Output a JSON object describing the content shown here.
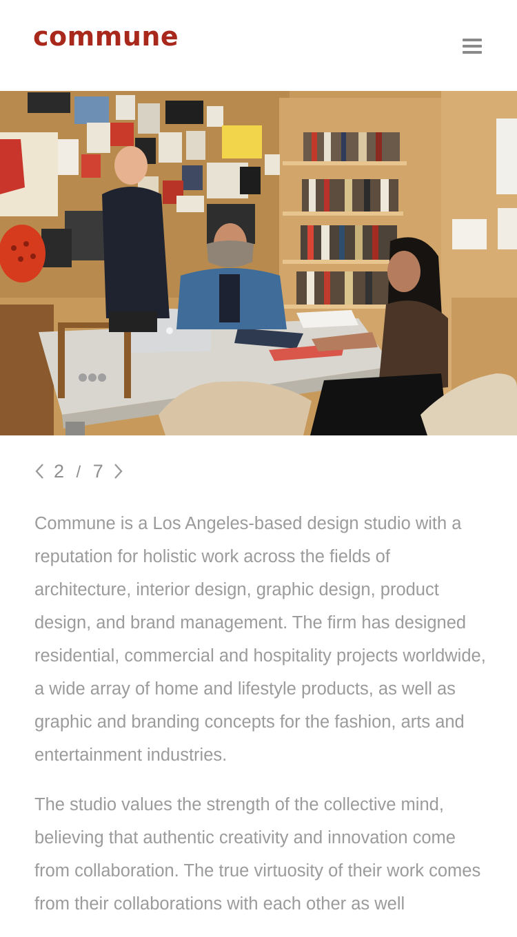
{
  "header": {
    "logo_text": "commune",
    "menu_icon": "hamburger-menu-icon"
  },
  "hero": {
    "image_description_icon": "photo-studio-meeting"
  },
  "pager": {
    "prev_icon": "chevron-left-icon",
    "current": "2",
    "separator": "/",
    "total": "7",
    "next_icon": "chevron-right-icon"
  },
  "content": {
    "paragraphs": [
      "Commune is a Los Angeles-based design studio with a reputation for holistic work across the fields of architecture, interior design, graphic design, product design, and brand management. The firm has designed residential, commercial and hospitality projects worldwide, a wide array of home and lifestyle products, as well as graphic and branding concepts for the fashion, arts and entertainment industries.",
      "The studio values the strength of the collective mind, believing that authentic creativity and innovation come from collaboration. The true virtuosity of their work comes from their collaborations with each other as well"
    ]
  },
  "colors": {
    "brand": "#a9281c",
    "body_text": "#9b9b9b",
    "pager_text": "#8e8e8e",
    "icon": "#8a8a8a"
  }
}
